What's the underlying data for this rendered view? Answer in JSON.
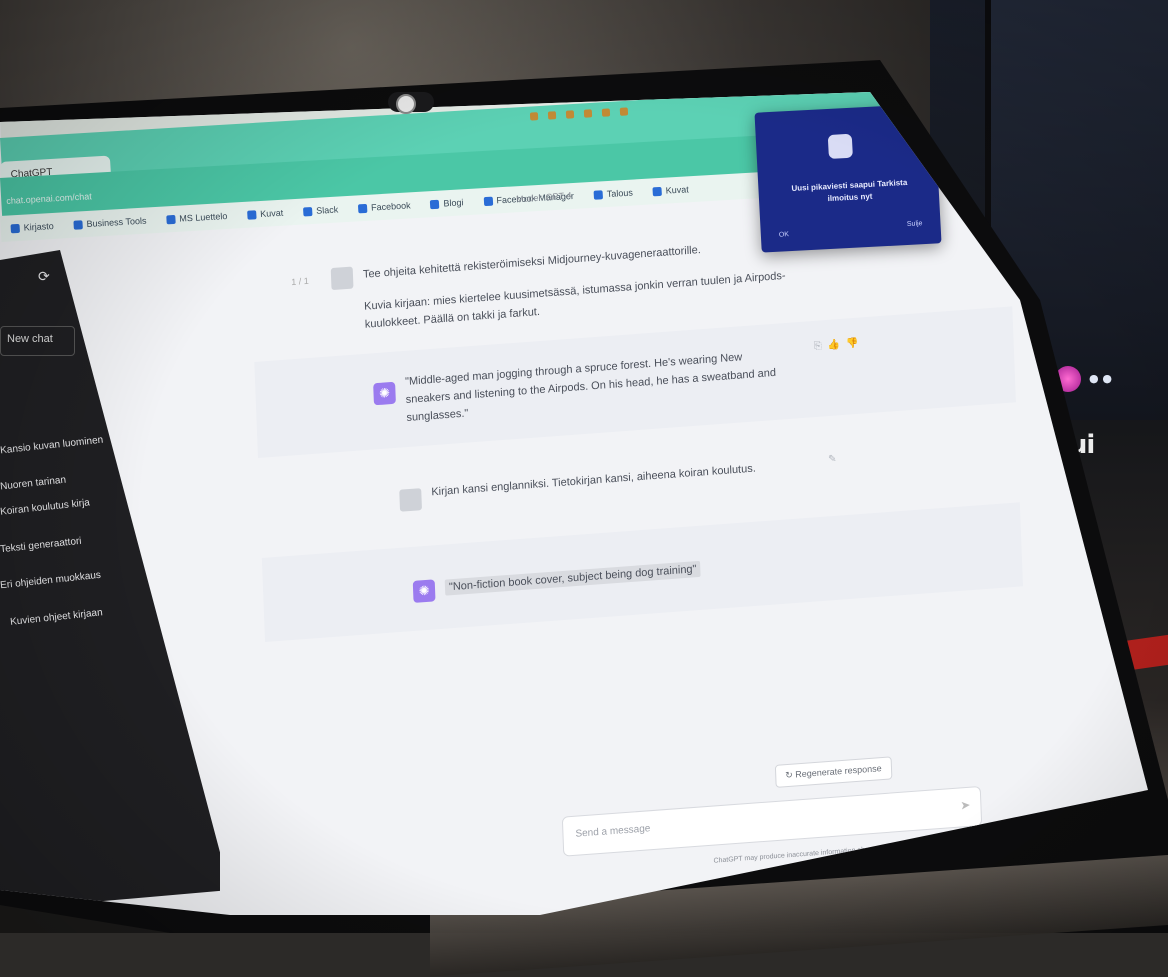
{
  "browser": {
    "tab_title": "ChatGPT",
    "url": "chat.openai.com/chat",
    "bookmarks": [
      "Kirjasto",
      "Business Tools",
      "MS Luettelo",
      "Kuvat",
      "Slack",
      "Facebook",
      "Blogi",
      "Facebook Manager",
      "Talous",
      "Kuvat"
    ]
  },
  "sidebar": {
    "new_chat_label": "New chat",
    "conversation_items": [
      "Kansio kuvan luominen",
      "Nuoren tarinan",
      "Koiran koulutus kirja",
      "Teksti generaattori",
      "Eri ohjeiden muokkaus",
      "Kuvien ohjeet kirjaan"
    ]
  },
  "chat": {
    "model_label": "Model: GPT-4",
    "pager_label": "1 / 1",
    "messages": [
      {
        "role": "user",
        "text": "Tee ohjeita kehitettä rekisteröimiseksi Midjourney-kuvageneraattorille."
      },
      {
        "role": "user-extra",
        "text": "Kuvia kirjaan: mies kiertelee kuusimetsässä, istumassa jonkin verran tuulen ja Airpods-kuulokkeet. Päällä on takki ja farkut."
      },
      {
        "role": "assistant",
        "text": "\"Middle-aged man jogging through a spruce forest. He's wearing New sneakers and listening to the Airpods. On his head, he has a sweatband and sunglasses.\""
      },
      {
        "role": "user",
        "text": "Kirjan kansi englanniksi. Tietokirjan kansi, aiheena koiran koulutus."
      },
      {
        "role": "assistant",
        "text": "\"Non-fiction book cover, subject being dog training\""
      }
    ],
    "regenerate_label": "Regenerate response",
    "input_placeholder": "Send a message",
    "footer_text": "ChatGPT may produce inaccurate information about people, places, or facts. ChatGPT Mar 23 Version"
  },
  "notification": {
    "text": "Uusi pikaviesti saapui\nTarkista ilmoitus nyt",
    "left_action": "OK",
    "right_action": "Sulje"
  },
  "background": {
    "monitor_brand": "Mui"
  }
}
